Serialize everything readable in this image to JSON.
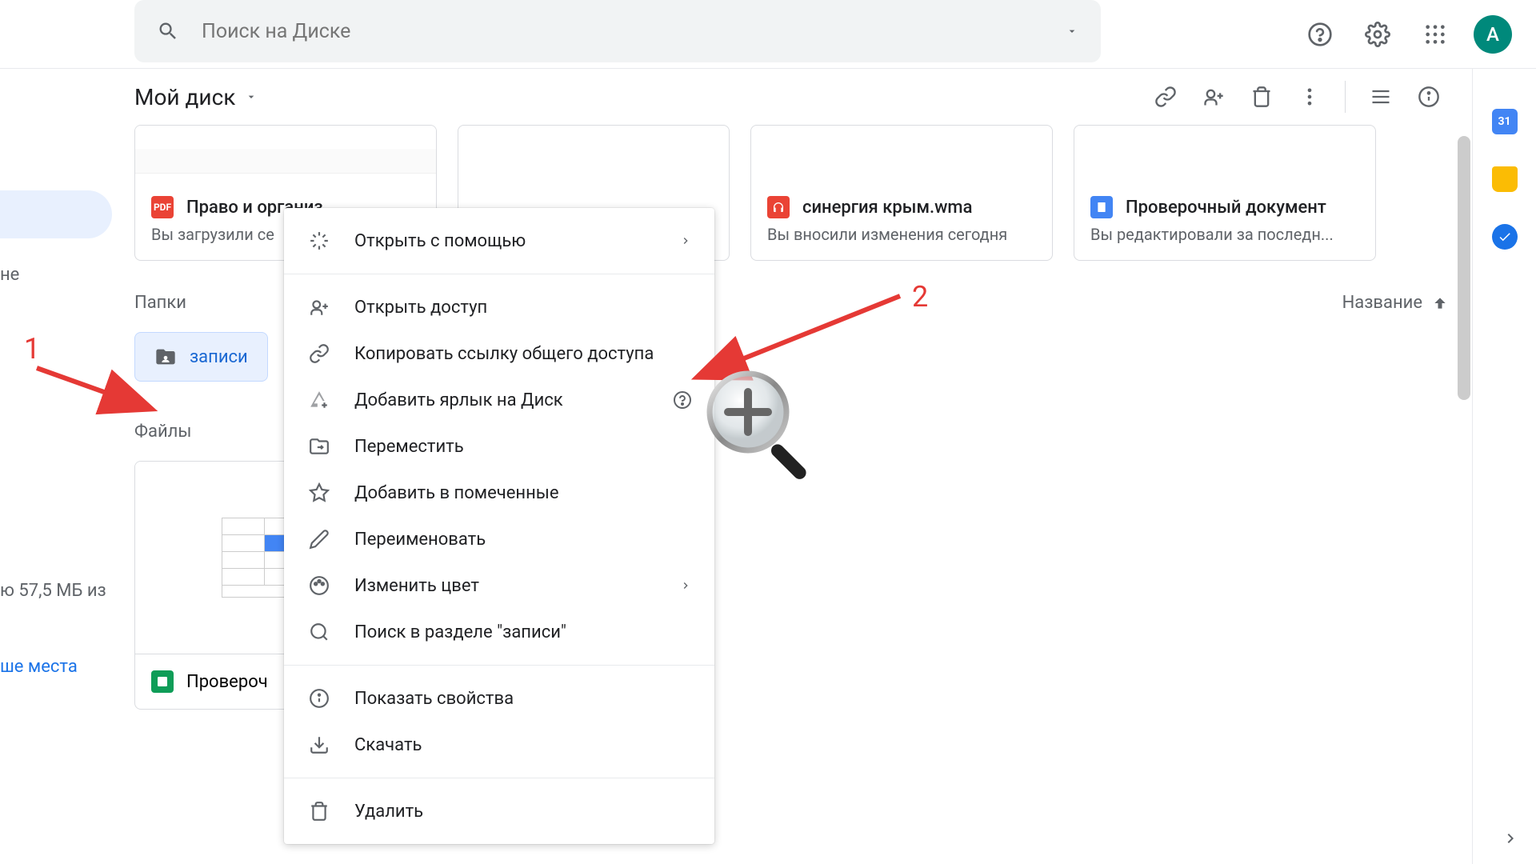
{
  "header": {
    "search_placeholder": "Поиск на Диске",
    "avatar_letter": "А"
  },
  "sidebar": {
    "item_text": "не",
    "storage_text": "ю 57,5 МБ из",
    "storage_link": "ше места"
  },
  "breadcrumb": {
    "title": "Мой диск"
  },
  "quick_access": [
    {
      "icon": "pdf",
      "title": "Право и организ...",
      "subtitle": "Вы загрузили се"
    },
    {
      "icon": "sheets",
      "title": "",
      "subtitle": ""
    },
    {
      "icon": "audio",
      "title": "синергия крым.wma",
      "subtitle": "Вы вносили изменения сегодня"
    },
    {
      "icon": "docs",
      "title": "Проверочный документ",
      "subtitle": "Вы редактировали за последн..."
    }
  ],
  "sections": {
    "folders_title": "Папки",
    "files_title": "Файлы",
    "sort_label": "Название"
  },
  "folder": {
    "name": "записи"
  },
  "files": [
    {
      "icon": "sheets",
      "title": "Провероч"
    }
  ],
  "context_menu": {
    "open_with": "Открыть с помощью",
    "share": "Открыть доступ",
    "copy_link": "Копировать ссылку общего доступа",
    "add_shortcut": "Добавить ярлык на Диск",
    "move": "Переместить",
    "add_starred": "Добавить в помеченные",
    "rename": "Переименовать",
    "change_color": "Изменить цвет",
    "search_in": "Поиск в разделе \"записи\"",
    "show_details": "Показать свойства",
    "download": "Скачать",
    "delete": "Удалить"
  },
  "annotations": {
    "label_1": "1",
    "label_2": "2"
  }
}
